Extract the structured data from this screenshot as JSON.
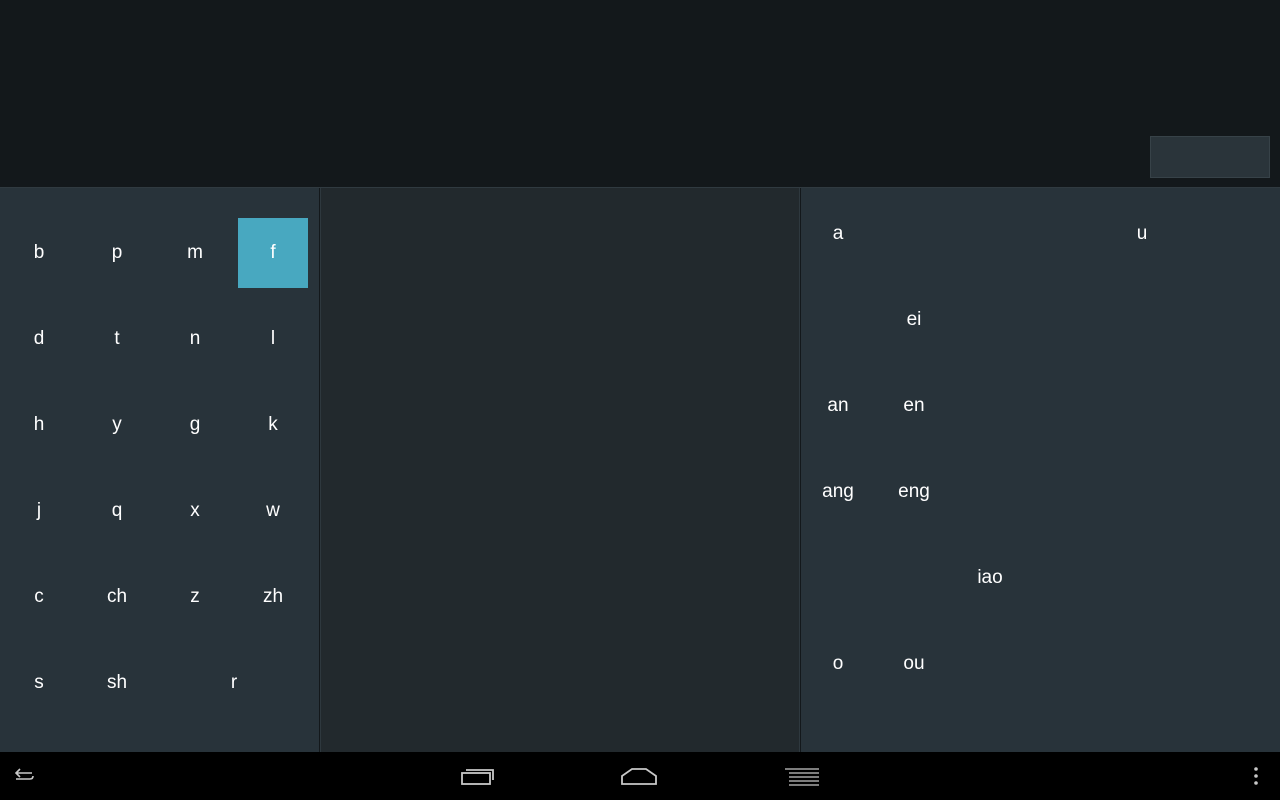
{
  "initials": {
    "rows": [
      [
        "b",
        "p",
        "m",
        "f"
      ],
      [
        "d",
        "t",
        "n",
        "l"
      ],
      [
        "h",
        "y",
        "g",
        "k"
      ],
      [
        "j",
        "q",
        "x",
        "w"
      ],
      [
        "c",
        "ch",
        "z",
        "zh"
      ],
      [
        "s",
        "sh",
        "r"
      ]
    ],
    "selected": "f"
  },
  "finals": {
    "keys": [
      "a",
      "u",
      "ei",
      "an",
      "en",
      "ang",
      "eng",
      "iao",
      "o",
      "ou"
    ]
  },
  "colors": {
    "selected_key": "#48a8c0",
    "panel_bg": "#28333a",
    "middle_bg": "#22292d",
    "top_bg": "#13181b",
    "nav_bg": "#000000"
  },
  "nav": {
    "icons": [
      "back-icon",
      "recent-apps-icon",
      "home-icon",
      "menu-lines-icon",
      "overflow-menu-icon"
    ]
  }
}
